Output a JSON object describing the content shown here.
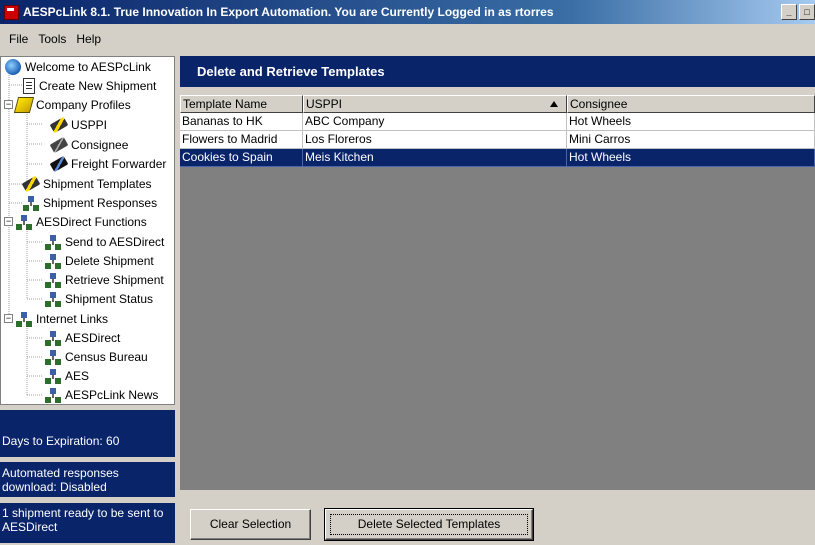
{
  "window": {
    "title": "AESPcLink 8.1. True Innovation In Export Automation. You are Currently Logged in as rtorres"
  },
  "menu": [
    "File",
    "Tools",
    "Help"
  ],
  "tree": [
    {
      "label": "Welcome to AESPcLink",
      "icon": "globe-icon"
    },
    {
      "label": "Create New Shipment",
      "icon": "document-icon"
    },
    {
      "label": "Company Profiles",
      "icon": "book-icon",
      "expander": "−"
    },
    {
      "label": "USPPI",
      "icon": "pen-icon"
    },
    {
      "label": "Consignee",
      "icon": "pen-icon"
    },
    {
      "label": "Freight Forwarder",
      "icon": "pen-icon"
    },
    {
      "label": "Shipment Templates",
      "icon": "pen-icon"
    },
    {
      "label": "Shipment Responses",
      "icon": "network-icon"
    },
    {
      "label": "AESDirect Functions",
      "icon": "network-icon",
      "expander": "−"
    },
    {
      "label": "Send to AESDirect",
      "icon": "network-icon"
    },
    {
      "label": "Delete Shipment",
      "icon": "network-icon"
    },
    {
      "label": "Retrieve Shipment",
      "icon": "network-icon"
    },
    {
      "label": "Shipment Status",
      "icon": "network-icon"
    },
    {
      "label": "Internet Links",
      "icon": "network-icon",
      "expander": "−"
    },
    {
      "label": "AESDirect",
      "icon": "network-icon"
    },
    {
      "label": "Census Bureau",
      "icon": "network-icon"
    },
    {
      "label": "AES",
      "icon": "network-icon"
    },
    {
      "label": "AESPcLink News",
      "icon": "network-icon"
    }
  ],
  "status": {
    "expiration": "Days to Expiration: 60",
    "auto_download": "Automated  responses download: Disabled",
    "ready": "1 shipment ready to be sent to AESDirect"
  },
  "main": {
    "header": "Delete and Retrieve Templates",
    "columns": [
      "Template Name",
      "USPPI",
      "Consignee"
    ],
    "rows": [
      {
        "template": "Bananas to HK",
        "usppi": "ABC Company",
        "consignee": "Hot Wheels"
      },
      {
        "template": "Flowers to Madrid",
        "usppi": "Los Floreros",
        "consignee": "Mini Carros"
      },
      {
        "template": "Cookies to Spain",
        "usppi": "Meis Kitchen",
        "consignee": "Hot Wheels"
      }
    ],
    "selected_row": "Cookies to Spain"
  },
  "buttons": {
    "clear": "Clear Selection",
    "delete": "Delete Selected Templates"
  }
}
